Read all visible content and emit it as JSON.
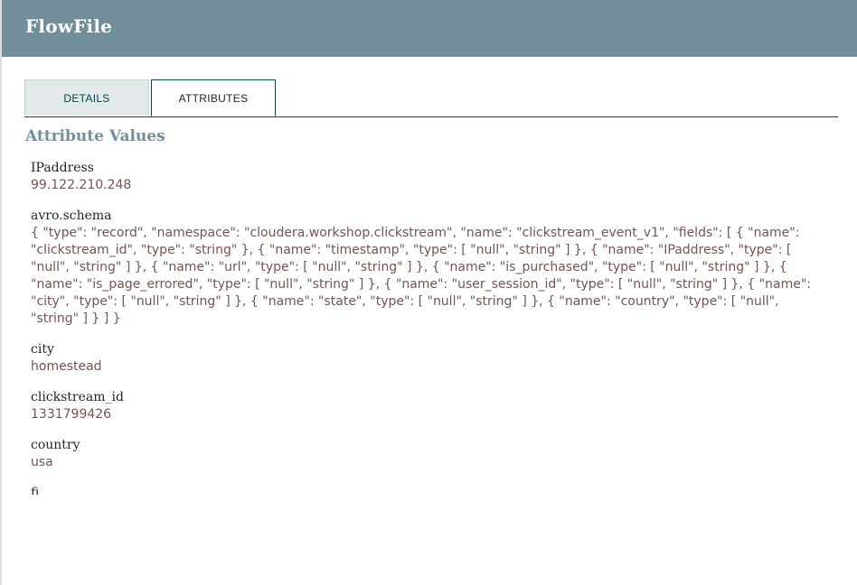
{
  "dialog": {
    "title": "FlowFile"
  },
  "tabs": [
    {
      "label": "DETAILS",
      "active": false
    },
    {
      "label": "ATTRIBUTES",
      "active": true
    }
  ],
  "section": {
    "title": "Attribute Values"
  },
  "attributes": [
    {
      "name": "IPaddress",
      "value": "99.122.210.248"
    },
    {
      "name": "avro.schema",
      "value": "{ \"type\": \"record\", \"namespace\": \"cloudera.workshop.clickstream\", \"name\": \"clickstream_event_v1\", \"fields\": [ { \"name\": \"clickstream_id\", \"type\": \"string\" }, { \"name\": \"timestamp\", \"type\": [ \"null\", \"string\" ] }, { \"name\": \"IPaddress\", \"type\": [ \"null\", \"string\" ] }, { \"name\": \"url\", \"type\": [ \"null\", \"string\" ] }, { \"name\": \"is_purchased\", \"type\": [ \"null\", \"string\" ] }, { \"name\": \"is_page_errored\", \"type\": [ \"null\", \"string\" ] }, { \"name\": \"user_session_id\", \"type\": [ \"null\", \"string\" ] }, { \"name\": \"city\", \"type\": [ \"null\", \"string\" ] }, { \"name\": \"state\", \"type\": [ \"null\", \"string\" ] }, { \"name\": \"country\", \"type\": [ \"null\", \"string\" ] } ] }"
    },
    {
      "name": "city",
      "value": "homestead"
    },
    {
      "name": "clickstream_id",
      "value": "1331799426"
    },
    {
      "name": "country",
      "value": "usa"
    },
    {
      "name": "fi",
      "value": ""
    }
  ],
  "colors": {
    "header_bg": "#728e9b",
    "accent": "#004849",
    "value_text": "#775351"
  }
}
